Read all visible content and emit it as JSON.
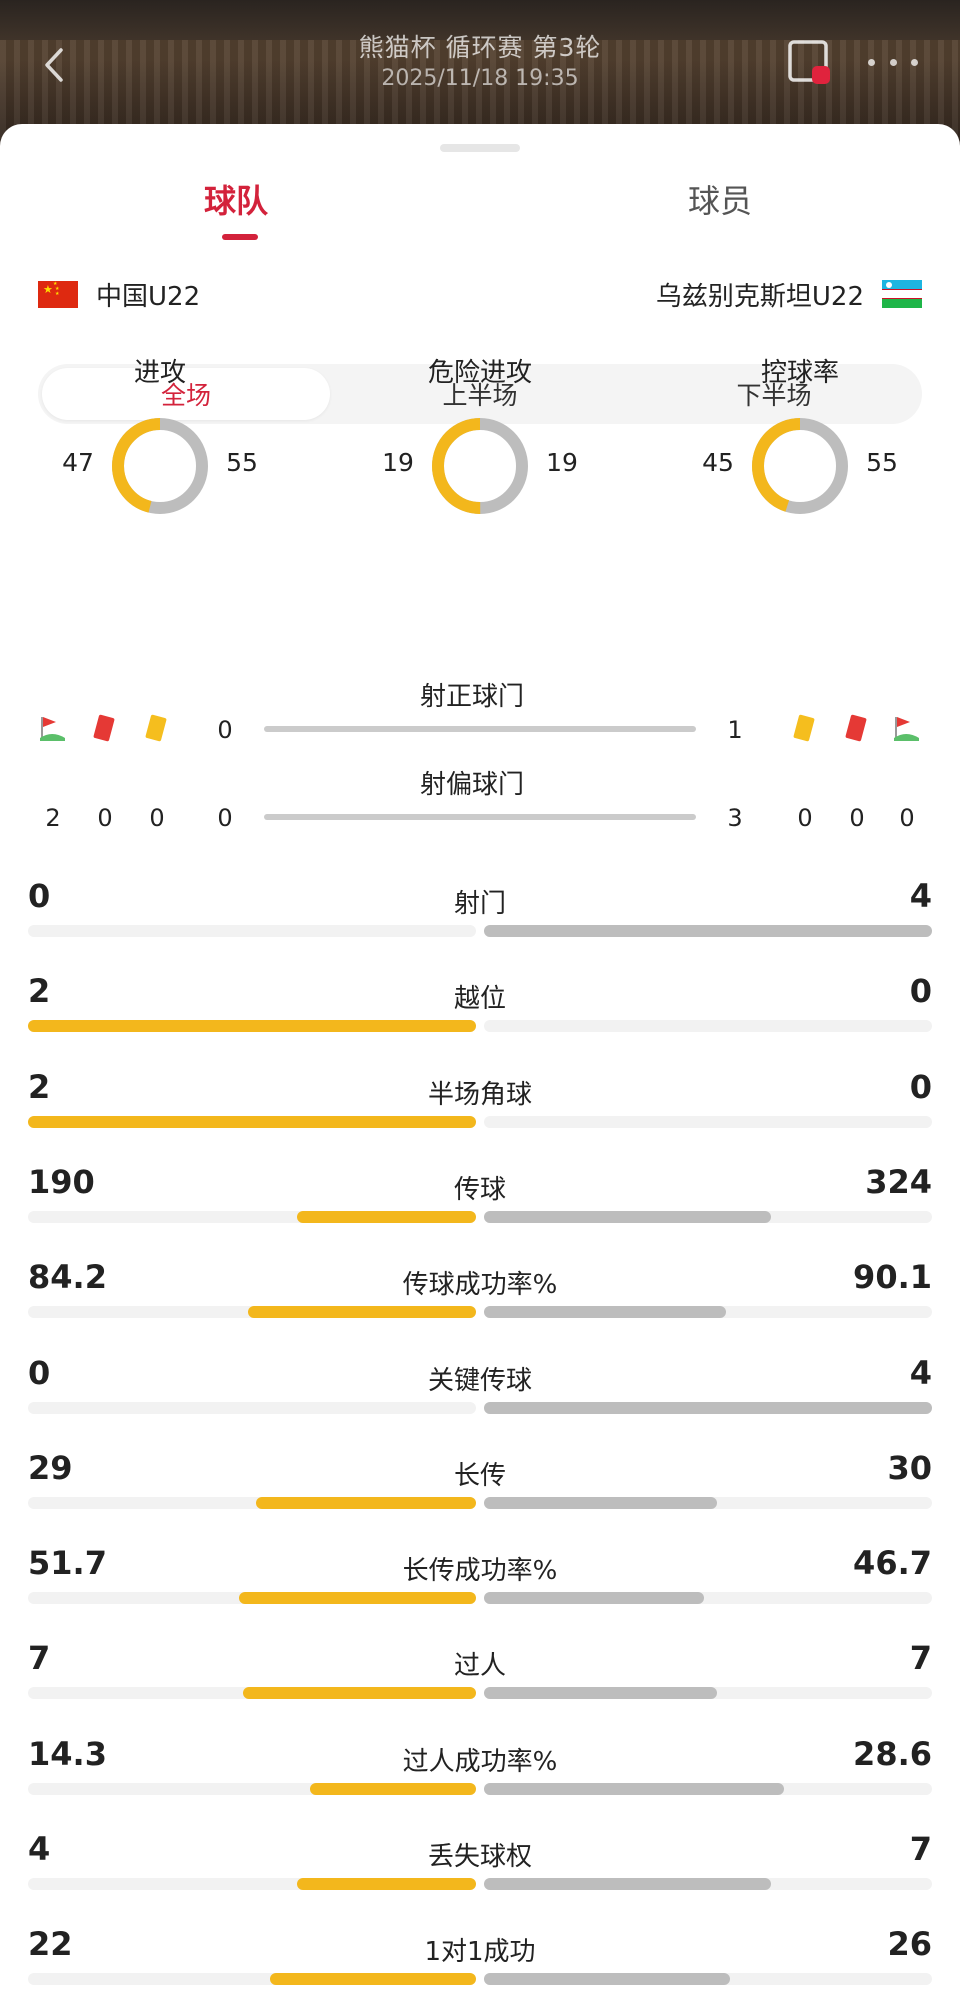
{
  "header": {
    "title": "熊猫杯 循环赛 第3轮",
    "datetime": "2025/11/18 19:35"
  },
  "tabs": [
    {
      "label": "球队",
      "active": true
    },
    {
      "label": "球员",
      "active": false
    }
  ],
  "teams": {
    "home": {
      "name": "中国U22",
      "flag": "china-flag"
    },
    "away": {
      "name": "乌兹别克斯坦U22",
      "flag": "uzbekistan-flag"
    }
  },
  "periods": [
    {
      "label": "全场",
      "active": true
    },
    {
      "label": "上半场",
      "active": false
    },
    {
      "label": "下半场",
      "active": false
    }
  ],
  "donuts": [
    {
      "label": "进攻",
      "home": 47,
      "away": 55
    },
    {
      "label": "危险进攻",
      "home": 19,
      "away": 19
    },
    {
      "label": "控球率",
      "home": 45,
      "away": 55
    }
  ],
  "shots": {
    "on_target": {
      "label": "射正球门",
      "home": 0,
      "away": 1
    },
    "off_target": {
      "label": "射偏球门",
      "home": 0,
      "away": 3
    }
  },
  "events": {
    "home": {
      "corners": 2,
      "red_cards": 0,
      "yellow_cards": 0
    },
    "away": {
      "corners": 0,
      "red_cards": 0,
      "yellow_cards": 0
    }
  },
  "stats": [
    {
      "label": "射门",
      "home": "0",
      "away": "4",
      "home_pct": 0,
      "away_pct": 100
    },
    {
      "label": "越位",
      "home": "2",
      "away": "0",
      "home_pct": 100,
      "away_pct": 0
    },
    {
      "label": "半场角球",
      "home": "2",
      "away": "0",
      "home_pct": 100,
      "away_pct": 0
    },
    {
      "label": "传球",
      "home": "190",
      "away": "324",
      "home_pct": 40,
      "away_pct": 64
    },
    {
      "label": "传球成功率%",
      "home": "84.2",
      "away": "90.1",
      "home_pct": 51,
      "away_pct": 54
    },
    {
      "label": "关键传球",
      "home": "0",
      "away": "4",
      "home_pct": 0,
      "away_pct": 100
    },
    {
      "label": "长传",
      "home": "29",
      "away": "30",
      "home_pct": 49,
      "away_pct": 52
    },
    {
      "label": "长传成功率%",
      "home": "51.7",
      "away": "46.7",
      "home_pct": 53,
      "away_pct": 49
    },
    {
      "label": "过人",
      "home": "7",
      "away": "7",
      "home_pct": 52,
      "away_pct": 52
    },
    {
      "label": "过人成功率%",
      "home": "14.3",
      "away": "28.6",
      "home_pct": 37,
      "away_pct": 67
    },
    {
      "label": "丢失球权",
      "home": "4",
      "away": "7",
      "home_pct": 40,
      "away_pct": 64
    },
    {
      "label": "1对1成功",
      "home": "22",
      "away": "26",
      "home_pct": 46,
      "away_pct": 55
    }
  ],
  "colors": {
    "accent": "#d3223b",
    "home_bar": "#f3b71c",
    "away_bar": "#bdbdbd"
  }
}
